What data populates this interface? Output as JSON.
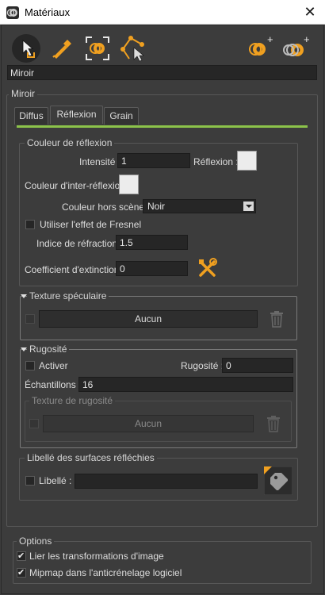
{
  "window": {
    "title": "Matériaux",
    "close_label": "✕"
  },
  "toolbar": {
    "icons": [
      "pointer-icon",
      "eyedropper-icon",
      "focus-material-icon",
      "path-select-icon",
      "add-material-icon",
      "add-multi-material-icon"
    ],
    "plus": "+"
  },
  "material_name": "Miroir",
  "main_group": {
    "title": "Miroir",
    "tabs": [
      {
        "label": "Diffus",
        "active": false
      },
      {
        "label": "Réflexion",
        "active": true
      },
      {
        "label": "Grain",
        "active": false
      }
    ],
    "accent_color": "#8cc34a"
  },
  "reflection_color": {
    "title": "Couleur de réflexion",
    "intensity_label": "Intensité :",
    "intensity_value": "1",
    "reflection_label": "Réflexion :",
    "interreflection_label": "Couleur d'inter-réflexion :",
    "offscene_label": "Couleur hors scène :",
    "offscene_value": "Noir",
    "fresnel_label": "Utiliser l'effet de Fresnel",
    "fresnel_checked": false,
    "refraction_label": "Indice de réfraction :",
    "refraction_value": "1.5",
    "extinction_label": "Coefficient d'extinction :",
    "extinction_value": "0",
    "tools_icon": "tools-icon"
  },
  "specular_texture": {
    "title": "Texture spéculaire",
    "button_label": "Aucun",
    "trash_icon": "trash-icon"
  },
  "roughness": {
    "title": "Rugosité",
    "activate_label": "Activer",
    "roughness_label": "Rugosité :",
    "roughness_value": "0",
    "samples_label": "Échantillons :",
    "samples_value": "16",
    "texture_title": "Texture de rugosité",
    "texture_button_label": "Aucun",
    "trash_icon": "trash-icon"
  },
  "reflective_label_group": {
    "title": "Libellé des surfaces réfléchies",
    "label_label": "Libellé :",
    "label_value": "",
    "tag_icon": "tag-icon"
  },
  "options": {
    "title": "Options",
    "items": [
      {
        "label": "Lier les transformations d'image",
        "checked": true
      },
      {
        "label": "Mipmap dans l'anticrénelage logiciel",
        "checked": true
      }
    ],
    "check_glyph": "✔"
  },
  "colors": {
    "accent": "#8cc34a",
    "tools": "#f0a020",
    "swatch": "#ececec"
  }
}
